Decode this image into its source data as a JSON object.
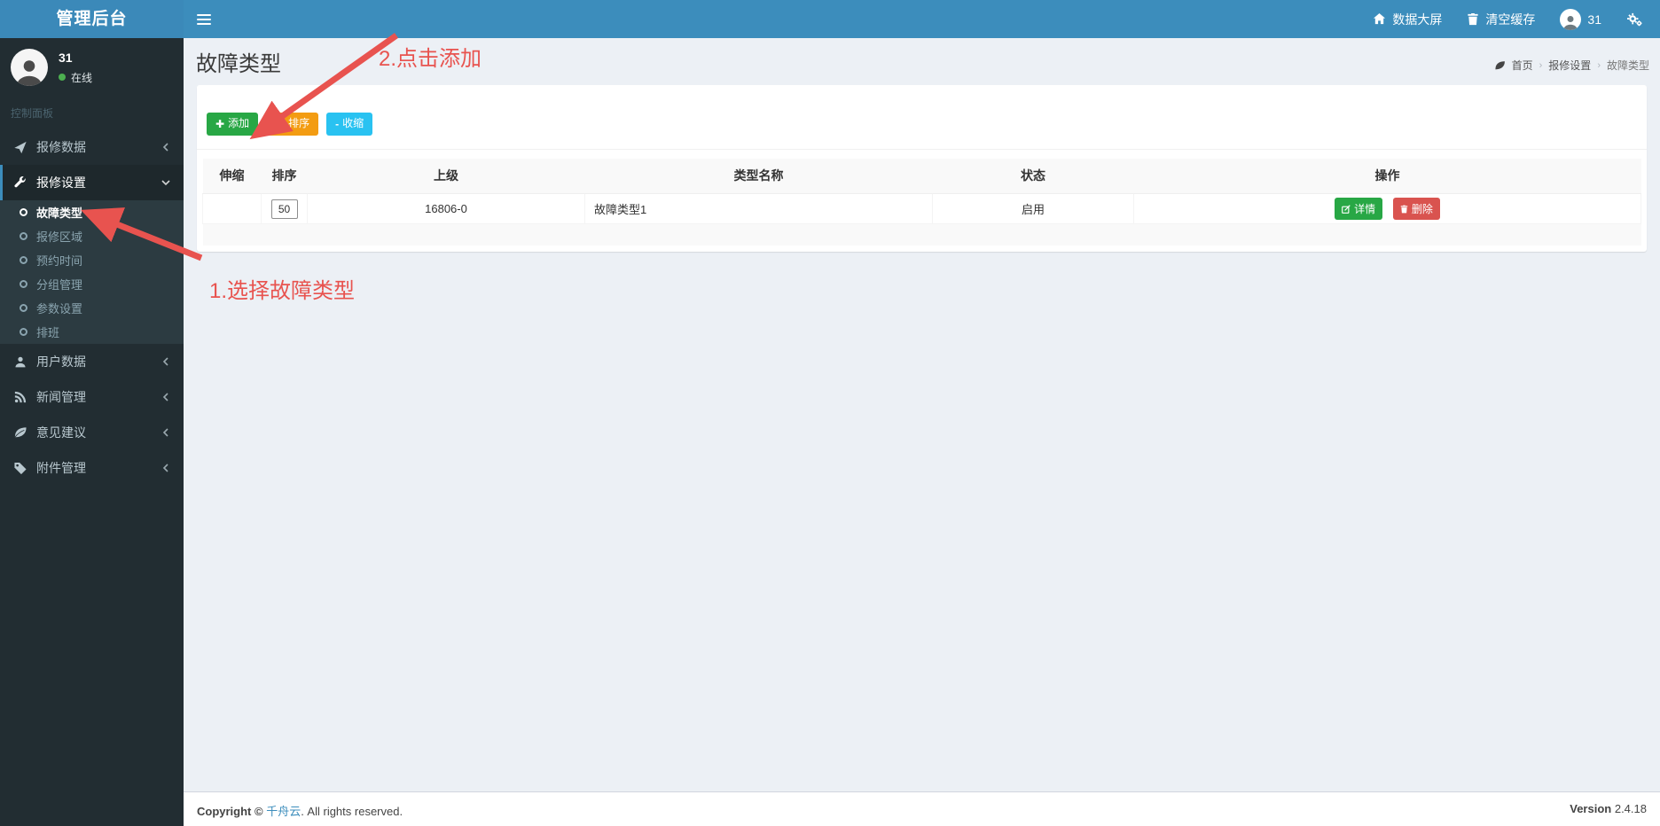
{
  "app": {
    "title": "管理后台"
  },
  "navbar": {
    "big_screen": "数据大屏",
    "clear_cache": "清空缓存",
    "user_badge": "31"
  },
  "sidebar": {
    "user": {
      "name": "31",
      "status": "在线"
    },
    "section_label": "控制面板",
    "menu": [
      {
        "label": "报修数据",
        "icon": "paper-plane-icon"
      },
      {
        "label": "报修设置",
        "icon": "wrench-icon",
        "children": [
          {
            "label": "故障类型",
            "active": true
          },
          {
            "label": "报修区域"
          },
          {
            "label": "预约时间"
          },
          {
            "label": "分组管理"
          },
          {
            "label": "参数设置"
          },
          {
            "label": "排班"
          }
        ]
      },
      {
        "label": "用户数据",
        "icon": "user-icon"
      },
      {
        "label": "新闻管理",
        "icon": "rss-icon"
      },
      {
        "label": "意见建议",
        "icon": "leaf-icon"
      },
      {
        "label": "附件管理",
        "icon": "tag-icon"
      }
    ]
  },
  "page": {
    "title": "故障类型",
    "breadcrumb": {
      "home": "首页",
      "section": "报修设置",
      "current": "故障类型"
    },
    "toolbar": {
      "add_label": "添加",
      "sort_label": "排序",
      "collapse_label": "收缩",
      "collapse_prefix": "-"
    },
    "table": {
      "columns": {
        "stretch": "伸缩",
        "sort": "排序",
        "parent": "上级",
        "type_name": "类型名称",
        "status": "状态",
        "actions": "操作"
      },
      "rows": [
        {
          "sort_value": "50",
          "parent": "16806-0",
          "type_name": "故障类型1",
          "status": "启用",
          "detail_label": "详情",
          "delete_label": "删除"
        }
      ]
    }
  },
  "annotations": {
    "step2": "2.点击添加",
    "step1": "1.选择故障类型"
  },
  "footer": {
    "copyright_prefix": "Copyright © ",
    "brand": "千舟云",
    "copyright_suffix": ". All rights reserved.",
    "version_label": "Version",
    "version_value": "2.4.18"
  },
  "colors": {
    "accent_blue": "#3c8dbc",
    "sidebar_dark": "#222d32",
    "submenu_dark": "#2c3b41",
    "button_green": "#28a745",
    "button_orange": "#f39c12",
    "button_cyan": "#29c2f1",
    "button_red": "#d9534f",
    "annotation_red": "#e8534f",
    "online_green": "#4caf50",
    "page_bg": "#ecf0f5"
  }
}
